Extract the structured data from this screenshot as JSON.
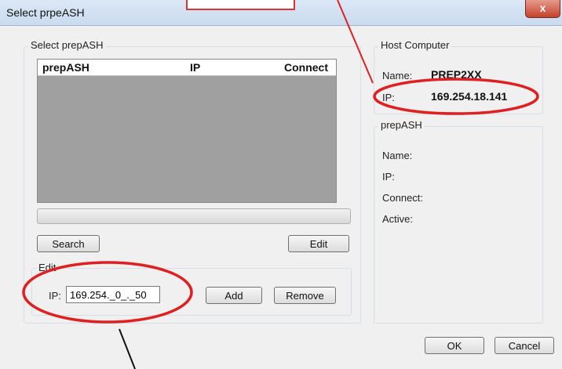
{
  "window": {
    "title": "Select prpeASH",
    "close_glyph": "x"
  },
  "select_group": {
    "legend": "Select prepASH",
    "columns": [
      "prepASH",
      "IP",
      "Connect"
    ],
    "search_label": "Search",
    "edit_label": "Edit"
  },
  "edit_group": {
    "legend": "Edit",
    "ip_label": "IP:",
    "ip_value": "169.254._0_._50",
    "add_label": "Add",
    "remove_label": "Remove"
  },
  "host": {
    "legend": "Host Computer",
    "name_label": "Name:",
    "name_value": "PREP2XX",
    "ip_label": "IP:",
    "ip_value": "169.254.18.141"
  },
  "prepash_info": {
    "legend": "prepASH",
    "name_label": "Name:",
    "ip_label": "IP:",
    "connect_label": "Connect:",
    "active_label": "Active:"
  },
  "footer": {
    "ok_label": "OK",
    "cancel_label": "Cancel"
  },
  "annotation_color": "#e02020"
}
